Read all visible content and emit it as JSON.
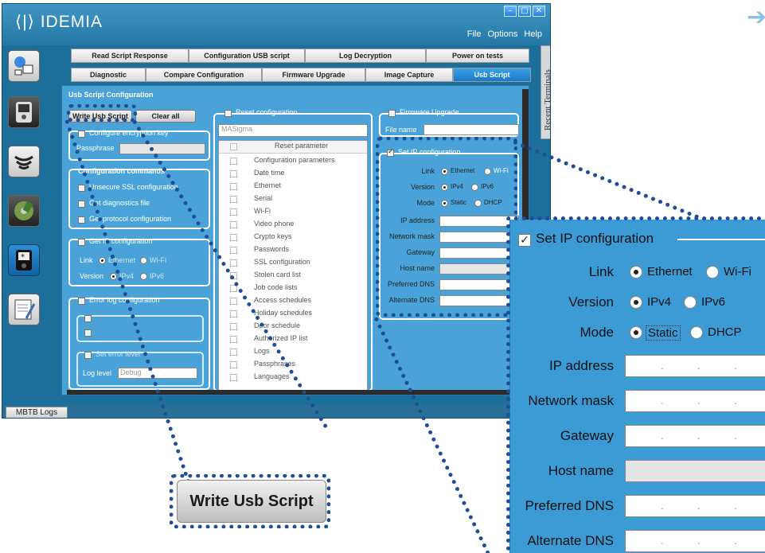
{
  "app": {
    "logo_text": "IDEMIA",
    "menu": [
      "File",
      "Options",
      "Help"
    ],
    "window_buttons": [
      "–",
      "□",
      "✕"
    ],
    "recent_terminals": "Recent Terminals"
  },
  "nav_icons": [
    "user-gear-icon",
    "terminal-settings-icon",
    "contactless-icon",
    "disk-icon",
    "keypad-terminal-icon",
    "notepad-icon"
  ],
  "tabs_row1": [
    "Read Script Response",
    "Configuration USB script",
    "Log Decryption",
    "Power on tests"
  ],
  "tabs_row2": [
    "Diagnostic",
    "Compare Configuration",
    "Firmware Upgrade",
    "Image Capture",
    "Usb Script"
  ],
  "panel": {
    "title": "Usb Script Configuration",
    "write_btn": "Write Usb Script",
    "clear_btn": "Clear all",
    "encryption_label": "Configure encryption key",
    "passphrase_label": "Passphrase",
    "config_cmds_label": "Configuration commands",
    "config_cmds": [
      "Unsecure SSL configuration",
      "Get diagnostics file",
      "Get protocol configuration"
    ],
    "get_ip_label": "Get IP configuration",
    "link_label": "Link",
    "version_label": "Version",
    "ethernet": "Ethernet",
    "wifi": "Wi-Fi",
    "ipv4": "IPv4",
    "ipv6": "IPv6",
    "error_log_label": "Error log configuration",
    "set_error_level": "Set error level",
    "log_level_label": "Log level",
    "log_level_value": "Debug",
    "reset_config_label": "Reset configuration",
    "reset_dropdown": "MASigma",
    "reset_header": "Reset parameter",
    "reset_items": [
      "Configuration parameters",
      "Date time",
      "Ethernet",
      "Serial",
      "Wi-Fi",
      "Video phone",
      "Crypto keys",
      "Passwords",
      "SSL configuration",
      "Stolen card list",
      "Job code lists",
      "Access schedules",
      "Holiday schedules",
      "Door schedule",
      "Authorized IP list",
      "Logs",
      "Passphrases",
      "Languages"
    ],
    "firmware_label": "Firmware Upgrade",
    "file_name_label": "File name",
    "set_ip_label": "Set IP configuration",
    "mode_label": "Mode",
    "static": "Static",
    "dhcp": "DHCP",
    "ip_fields": [
      "IP address",
      "Network mask",
      "Gateway",
      "Host name",
      "Preferred DNS",
      "Alternate DNS"
    ]
  },
  "status": {
    "mbtb_logs": "MBTB Logs"
  },
  "zoom_ip": {
    "title": "Set IP configuration",
    "link": "Link",
    "ethernet": "Ethernet",
    "wifi": "Wi-Fi",
    "version": "Version",
    "ipv4": "IPv4",
    "ipv6": "IPv6",
    "mode": "Mode",
    "static": "Static",
    "dhcp": "DHCP",
    "fields": [
      "IP address",
      "Network mask",
      "Gateway",
      "Host name",
      "Preferred DNS",
      "Alternate DNS"
    ]
  },
  "zoom_btn": "Write Usb Script",
  "arrow": "➔",
  "colors": {
    "accent": "#1c7ac4",
    "callout": "#1f4e96"
  }
}
